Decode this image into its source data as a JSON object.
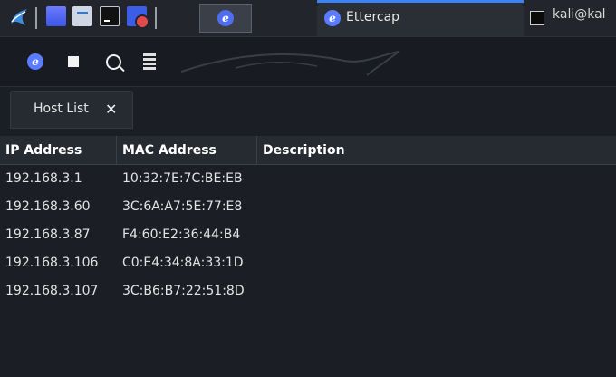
{
  "taskbar": {
    "launchers": [
      {
        "icon": "kali-menu-icon"
      },
      {
        "icon": "desktop-icon"
      },
      {
        "icon": "file-manager-icon"
      },
      {
        "icon": "terminal-icon"
      },
      {
        "icon": "screen-recorder-icon"
      }
    ],
    "active_task_icon": "ettercap-icon",
    "tasks": [
      {
        "label": "Ettercap",
        "icon": "ettercap-icon"
      },
      {
        "label": "kali@kal",
        "icon": "terminal-icon"
      }
    ],
    "accent": "#3b82f6"
  },
  "toolbar": {
    "buttons": [
      {
        "icon": "ettercap-logo-icon"
      },
      {
        "icon": "stop-icon"
      },
      {
        "icon": "search-icon"
      },
      {
        "icon": "server-icon"
      }
    ]
  },
  "tabs": [
    {
      "label": "Host List",
      "close": "✕"
    }
  ],
  "table": {
    "columns": [
      "IP Address",
      "MAC Address",
      "Description"
    ],
    "rows": [
      {
        "ip": "192.168.3.1",
        "mac": "10:32:7E:7C:BE:EB",
        "desc": ""
      },
      {
        "ip": "192.168.3.60",
        "mac": "3C:6A:A7:5E:77:E8",
        "desc": ""
      },
      {
        "ip": "192.168.3.87",
        "mac": "F4:60:E2:36:44:B4",
        "desc": ""
      },
      {
        "ip": "192.168.3.106",
        "mac": "C0:E4:34:8A:33:1D",
        "desc": ""
      },
      {
        "ip": "192.168.3.107",
        "mac": "3C:B6:B7:22:51:8D",
        "desc": ""
      }
    ]
  }
}
